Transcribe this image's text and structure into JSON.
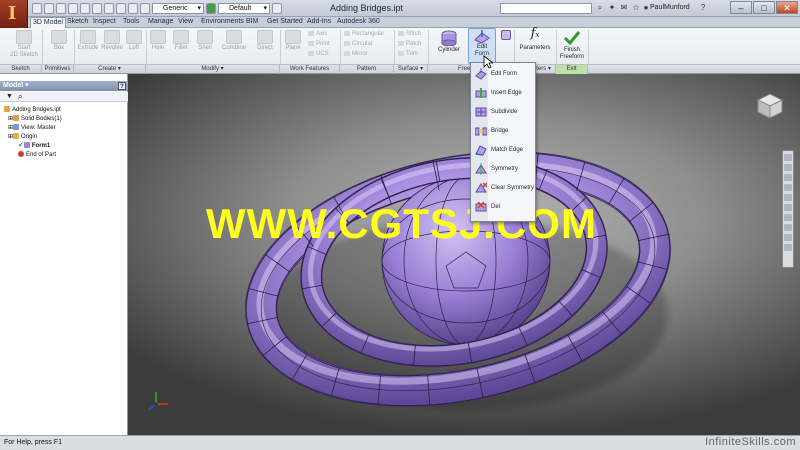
{
  "window": {
    "title": "Adding Bridges.ipt",
    "user": "PaulMunford",
    "material": "Generic",
    "appearance": "Default"
  },
  "tabs": [
    "3D Model",
    "Sketch",
    "Inspect",
    "Tools",
    "Manage",
    "View",
    "Environments",
    "BIM",
    "Get Started",
    "Add-Ins",
    "Autodesk 360"
  ],
  "ribbon": {
    "sketch": {
      "start_2d_sketch_1": "Start",
      "start_2d_sketch_2": "2D Sketch"
    },
    "primitives": {
      "box": "Box"
    },
    "create": {
      "extrude": "Extrude",
      "revolve": "Revolve",
      "loft": "Loft"
    },
    "modify": {
      "hole": "Hole",
      "fillet": "Fillet",
      "shell": "Shell",
      "combine": "Combine",
      "direct": "Direct"
    },
    "work_features": {
      "plane": "Plane",
      "axis": "Axis",
      "point": "Point",
      "ucs": "UCS"
    },
    "pattern": {
      "rectangular": "Rectangular",
      "circular": "Circular",
      "mirror": "Mirror"
    },
    "surface": {
      "stitch": "Stitch",
      "patch": "Patch",
      "trim": "Trim"
    },
    "freeform": {
      "cylinder": "Cylinder",
      "edit_form_1": "Edit",
      "edit_form_2": "Form"
    },
    "parameters": "Parameters",
    "finish_1": "Finish",
    "finish_2": "Freeform"
  },
  "panels": {
    "sketch": "Sketch",
    "primitives": "Primitives",
    "create": "Create ▾",
    "modify": "Modify ▾",
    "work_features": "Work Features",
    "pattern": "Pattern",
    "surface": "Surface ▾",
    "freeform": "Free",
    "parameters": "eters ▾",
    "exit": "Exit"
  },
  "browser": {
    "title": "Model ▾",
    "help": "?",
    "items": [
      {
        "label": "Adding Bridges.ipt"
      },
      {
        "label": "Solid Bodies(1)"
      },
      {
        "label": "View: Master"
      },
      {
        "label": "Origin"
      },
      {
        "label": "Form1"
      },
      {
        "label": "End of Part"
      }
    ]
  },
  "dropdown_menu": [
    {
      "label": "Edit Form",
      "icon": "edit-form-icon"
    },
    {
      "label": "Insert Edge",
      "icon": "insert-edge-icon"
    },
    {
      "label": "Subdivide",
      "icon": "subdivide-icon"
    },
    {
      "label": "Bridge",
      "icon": "bridge-icon"
    },
    {
      "label": "Match Edge",
      "icon": "match-edge-icon"
    },
    {
      "label": "Symmetry",
      "icon": "symmetry-icon"
    },
    {
      "label": "Clear Symmetry",
      "icon": "clear-symmetry-icon"
    },
    {
      "label": "Del",
      "icon": "delete-icon"
    }
  ],
  "watermark": "WWW.CGTSJ.COM",
  "status": {
    "help": "For Help, press F1",
    "brand": "InfiniteSkills.com"
  },
  "colors": {
    "accent": "#9a7fd6",
    "watermark": "#ffff1e",
    "exit_panel": "#bfe0a6"
  }
}
